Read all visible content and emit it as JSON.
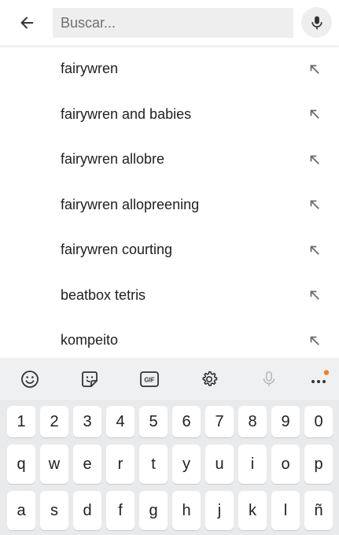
{
  "search": {
    "placeholder": "Buscar..."
  },
  "suggestions": [
    "fairywren",
    "fairywren and babies",
    "fairywren allobre",
    "fairywren allopreening",
    "fairywren courting",
    "beatbox tetris",
    "kompeito"
  ],
  "icons": {
    "back": "arrow-left-icon",
    "mic": "microphone-icon",
    "suggestion_fill": "arrow-up-left-icon",
    "toolbar": [
      "emoji-icon",
      "sticker-icon",
      "gif-icon",
      "settings-icon",
      "microphone-icon",
      "more-icon"
    ]
  },
  "keyboard": {
    "gif_label": "GIF",
    "numbers": [
      "1",
      "2",
      "3",
      "4",
      "5",
      "6",
      "7",
      "8",
      "9",
      "0"
    ],
    "row1": [
      "q",
      "w",
      "e",
      "r",
      "t",
      "y",
      "u",
      "i",
      "o",
      "p"
    ],
    "row2": [
      "a",
      "s",
      "d",
      "f",
      "g",
      "h",
      "j",
      "k",
      "l",
      "ñ"
    ]
  },
  "colors": {
    "accent_dot": "#f48024",
    "keyboard_bg": "#e9eaec",
    "icon_gray": "#6b6b6b"
  }
}
